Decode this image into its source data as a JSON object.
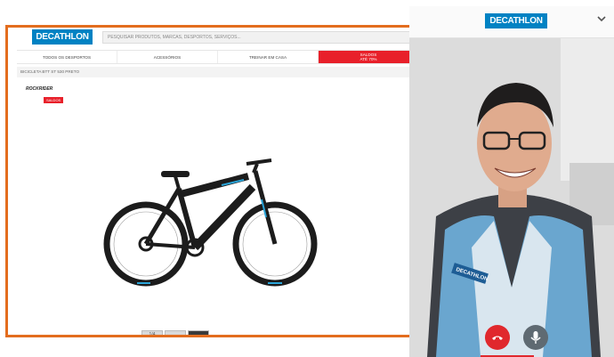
{
  "site": {
    "logo": "DECATHLON",
    "search_placeholder": "PESQUISAR PRODUTOS, MARCAS, DESPORTOS, SERVIÇOS...",
    "nav": [
      {
        "label": "TODOS OS DESPORTOS"
      },
      {
        "label": "ACESSÓRIOS"
      },
      {
        "label": "TREINAR EM CASA"
      },
      {
        "label_line1": "SALDOS",
        "label_line2": "ATÉ 70%"
      }
    ],
    "breadcrumb": "BICICLETA BTT ST 530 PRETO",
    "brand": "ROCKRIDER",
    "promo_badge": "SALDOS",
    "thumbnails": [
      "1/4",
      "",
      ""
    ]
  },
  "call": {
    "logo": "DECATHLON",
    "vest_text": "DECATHLON"
  },
  "colors": {
    "brand_blue": "#0082c3",
    "frame_orange": "#e36d1e",
    "sale_red": "#e8202a",
    "hangup_red": "#e0282d"
  },
  "icons": [
    "chevron-down-icon",
    "hangup-icon",
    "microphone-icon"
  ]
}
